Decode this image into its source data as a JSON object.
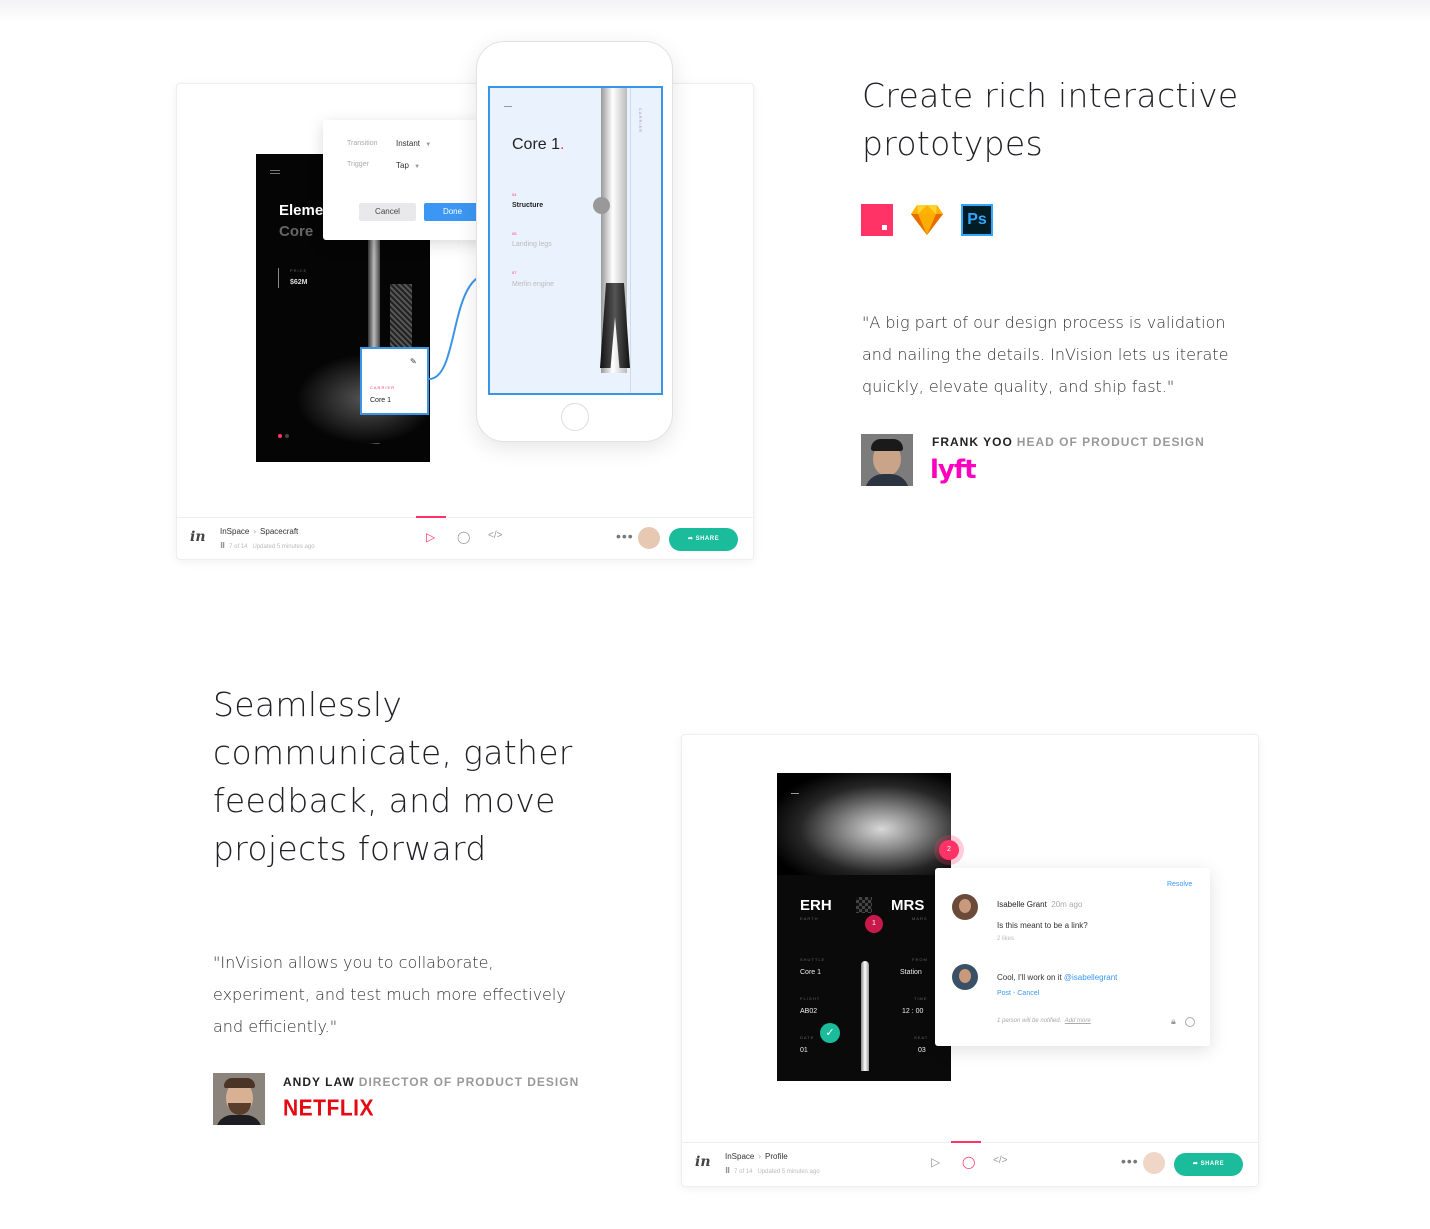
{
  "section1": {
    "heading": "Create rich interactive prototypes",
    "heading_line1": "Create rich interactive",
    "heading_line2": "prototypes",
    "tool_icons": [
      "invision-studio-icon",
      "sketch-icon",
      "photoshop-icon"
    ],
    "photoshop_label": "Ps",
    "quote_line1": "\"A big part of our design process is validation",
    "quote_line2": "and nailing the details. InVision lets us iterate",
    "quote_line3": "quickly, elevate quality, and ship fast.\"",
    "author_name": "FRANK YOO",
    "author_role": "HEAD OF PRODUCT DESIGN",
    "company": "lyft",
    "mockup": {
      "transition_label": "Transition",
      "transition_value": "Instant",
      "trigger_label": "Trigger",
      "trigger_value": "Tap",
      "cancel": "Cancel",
      "done": "Done",
      "dark_title_1": "Eleme",
      "dark_title_2": "Core",
      "price_label": "PRICE",
      "price": "$62M",
      "carrier_label": "CARRIER",
      "carrier_value": "Core 1",
      "phone_title": "Core 1",
      "item1_num": "04",
      "item1": "Structure",
      "item2_num": "05",
      "item2": "Landing legs",
      "item3_num": "07",
      "item3": "Merlin engine",
      "vertical_label": "CARRIER"
    },
    "bar": {
      "project": "InSpace",
      "screen": "Spacecraft",
      "count": "7 of 14",
      "updated": "Updated 5 minutes ago",
      "share": "SHARE"
    }
  },
  "section2": {
    "heading_line1": "Seamlessly",
    "heading_line2": "communicate, gather",
    "heading_line3": "feedback, and move",
    "heading_line4": "projects forward",
    "quote_line1": "\"InVision allows you to collaborate,",
    "quote_line2": "experiment, and test much more effectively",
    "quote_line3": "and efficiently.\"",
    "author_name": "ANDY LAW",
    "author_role": "DIRECTOR OF PRODUCT DESIGN",
    "company": "NETFLIX",
    "mockup": {
      "from": "ERH",
      "from_sub": "EARTH",
      "to": "MRS",
      "to_sub": "MARS",
      "shuttle_label": "SHUTTLE",
      "shuttle": "Core 1",
      "from_label": "FROM",
      "from_value": "Station",
      "flight_label": "FLIGHT",
      "flight": "AB02",
      "time_label": "TIME",
      "time": "12 : 00",
      "date_label": "DATE",
      "date": "01",
      "seat_label": "SEAT",
      "seat": "03",
      "pin_top": "2",
      "pin_mid": "1",
      "resolve": "Resolve",
      "c1_name": "Isabelle Grant",
      "c1_time": "20m ago",
      "c1_text": "Is this meant to be a link?",
      "c1_likes": "2 likes",
      "c2_text": "Cool, I'll work on it",
      "c2_mention": "@isabellegrant",
      "post": "Post",
      "cancel": "Cancel",
      "notify": "1 person will be notified.",
      "add_more": "Add more"
    },
    "bar": {
      "project": "InSpace",
      "screen": "Profile",
      "count": "7 of 14",
      "updated": "Updated 5 minutes ago",
      "share": "SHARE"
    }
  }
}
